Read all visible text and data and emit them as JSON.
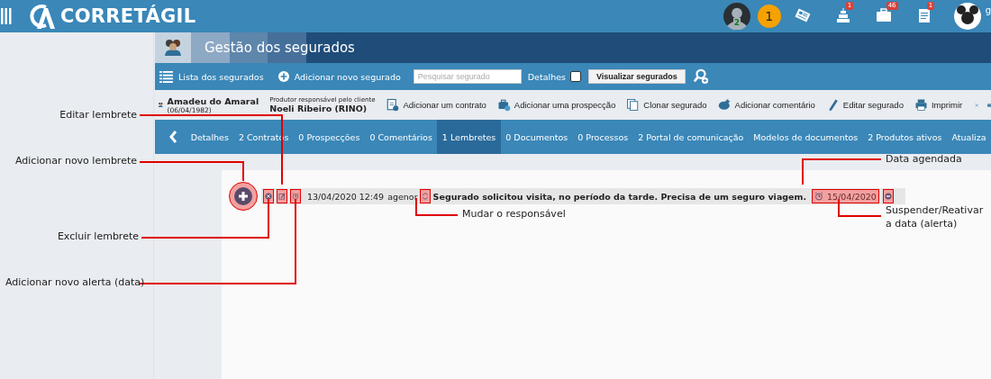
{
  "topbar": {
    "logo_text": "CORRETÁGIL",
    "user_count": "2",
    "notification_count": "1",
    "icons": [
      {
        "kind": "news"
      },
      {
        "kind": "cake",
        "badge": "1"
      },
      {
        "kind": "briefcase",
        "badge": "46"
      },
      {
        "kind": "notes",
        "badge": "1"
      }
    ],
    "user_name": "g"
  },
  "page_title": "Gestão dos segurados",
  "toolbar": {
    "list_link": "Lista dos segurados",
    "add_link": "Adicionar novo segurado",
    "search": {
      "placeholder": "Pesquisar segurado"
    },
    "details_label": "Detalhes",
    "details_checked": false,
    "view_button": "Visualizar segurados"
  },
  "client": {
    "name": "Amadeu do Amaral",
    "birth_date": "(06/04/1982)",
    "producer_label": "Produtor responsável pelo cliente",
    "producer": "Noeli Ribeiro (RINO)",
    "actions": [
      {
        "kind": "contract",
        "label": "Adicionar um contrato"
      },
      {
        "kind": "prospect",
        "label": "Adicionar uma prospecção"
      },
      {
        "kind": "clone",
        "label": "Clonar segurado"
      },
      {
        "kind": "comment",
        "label": "Adicionar comentário"
      },
      {
        "kind": "edit",
        "label": "Editar segurado"
      },
      {
        "kind": "print",
        "label": "Imprimir"
      },
      {
        "kind": "close"
      },
      {
        "kind": "mail"
      }
    ]
  },
  "tabs": [
    {
      "label": "Detalhes",
      "selected": false
    },
    {
      "label": "2 Contratos",
      "selected": false
    },
    {
      "label": "0 Prospecções",
      "selected": false
    },
    {
      "label": "0 Comentários",
      "selected": false
    },
    {
      "label": "1 Lembretes",
      "selected": true
    },
    {
      "label": "0 Documentos",
      "selected": false
    },
    {
      "label": "0 Processos",
      "selected": false
    },
    {
      "label": "2 Portal de comunicação",
      "selected": false
    },
    {
      "label": "Modelos de documentos",
      "selected": false
    },
    {
      "label": "2 Produtos ativos",
      "selected": false
    },
    {
      "label": "Atualiza",
      "selected": false
    }
  ],
  "reminder": {
    "datetime": "13/04/2020 12:49",
    "user": "agenor",
    "text": "Segurado solicitou visita, no período da tarde. Precisa de um seguro viagem.",
    "due_date": "15/04/2020"
  },
  "annotations": [
    {
      "label": "Editar lembrete"
    },
    {
      "label": "Adicionar novo lembrete"
    },
    {
      "label": "Excluir lembrete"
    },
    {
      "label": "Adicionar novo alerta (data)"
    },
    {
      "label": "Mudar o responsável"
    },
    {
      "label": "Data agendada"
    },
    {
      "label": "Suspender/Reativar a data (alerta)"
    }
  ]
}
